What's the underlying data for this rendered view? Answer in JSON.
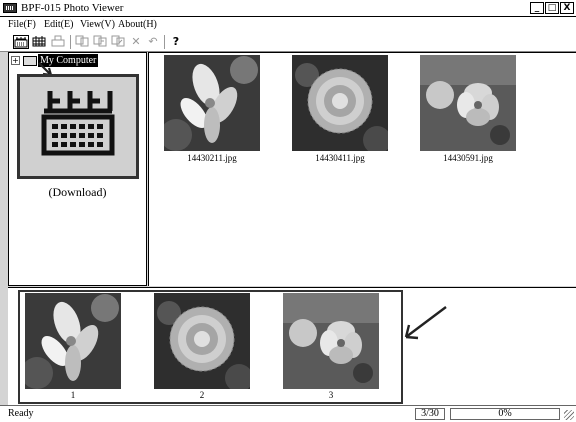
{
  "window": {
    "title": "BPF-015 Photo Viewer",
    "buttons": {
      "minimize": "_",
      "maximize": "□",
      "close": "X"
    }
  },
  "menu": [
    {
      "label": "File(F)"
    },
    {
      "label": "Edit(E)"
    },
    {
      "label": "View(V)"
    },
    {
      "label": "About(H)"
    }
  ],
  "toolbar": {
    "icons": [
      "download-icon",
      "grid-icon",
      "print-icon",
      "copy-icon",
      "copy-all-icon",
      "move-icon",
      "delete-icon",
      "undo-icon",
      "help-icon"
    ],
    "delete_glyph": "✕",
    "undo_glyph": "↶",
    "help_glyph": "?"
  },
  "tree": {
    "expand_glyph": "+",
    "root_label": "My Computer",
    "download_label": "(Download)"
  },
  "thumbnails": [
    {
      "filename": "14430211.jpg"
    },
    {
      "filename": "14430411.jpg"
    },
    {
      "filename": "14430591.jpg"
    }
  ],
  "strip": [
    {
      "index": "1"
    },
    {
      "index": "2"
    },
    {
      "index": "3"
    }
  ],
  "status": {
    "text": "Ready",
    "count": "3/30",
    "progress": "0%"
  }
}
